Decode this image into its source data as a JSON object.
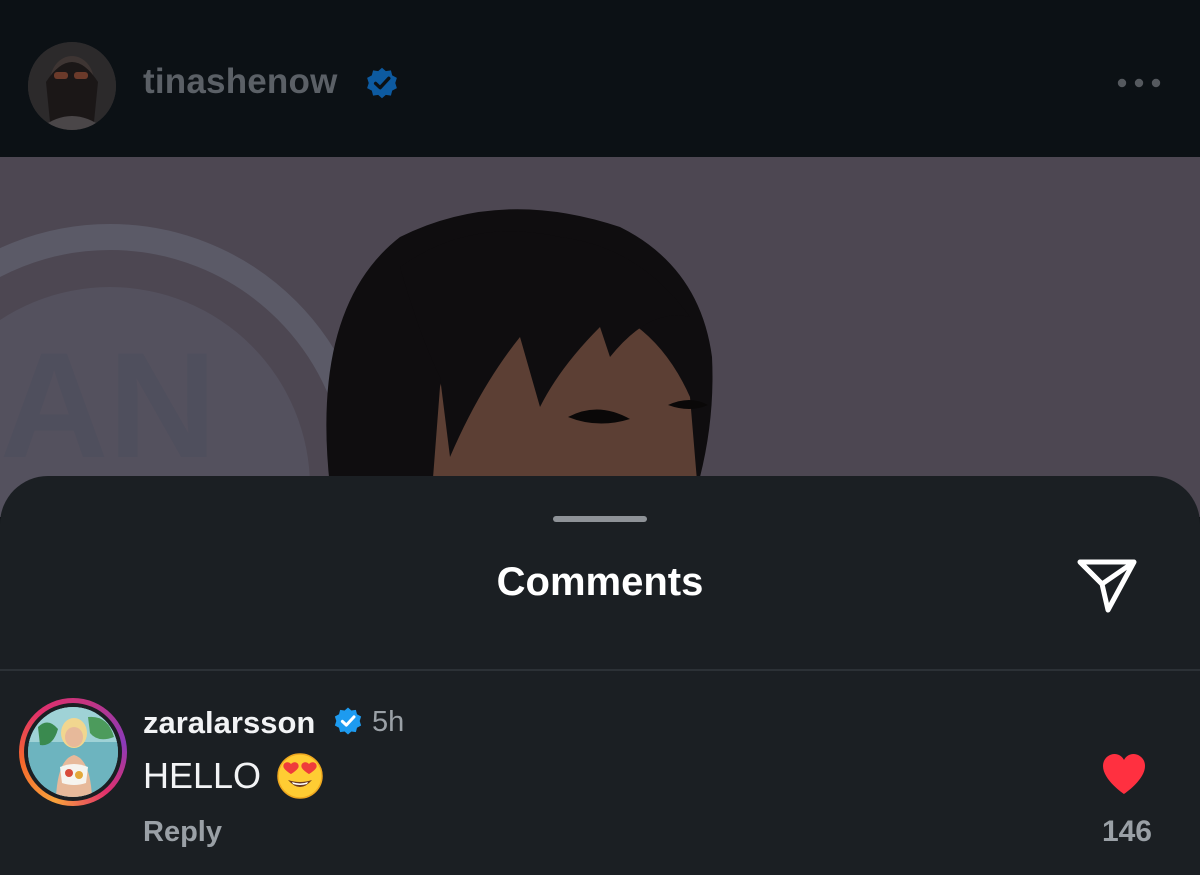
{
  "post": {
    "username": "tinashenow",
    "verified": true,
    "avatar_icon": "profile-photo",
    "more_icon": "more-dots-icon"
  },
  "comments_sheet": {
    "title": "Comments",
    "share_icon": "paper-plane-icon"
  },
  "comments": [
    {
      "username": "zaralarsson",
      "verified": true,
      "time": "5h",
      "text": "HELLO",
      "emoji": "heart-eyes-emoji",
      "reply_label": "Reply",
      "liked": true,
      "like_count": "146"
    }
  ],
  "colors": {
    "sheet_bg": "#1b1f23",
    "verified_blue": "#1d9bf0",
    "like_red": "#ff3040",
    "muted_text": "#9aa0a6"
  }
}
